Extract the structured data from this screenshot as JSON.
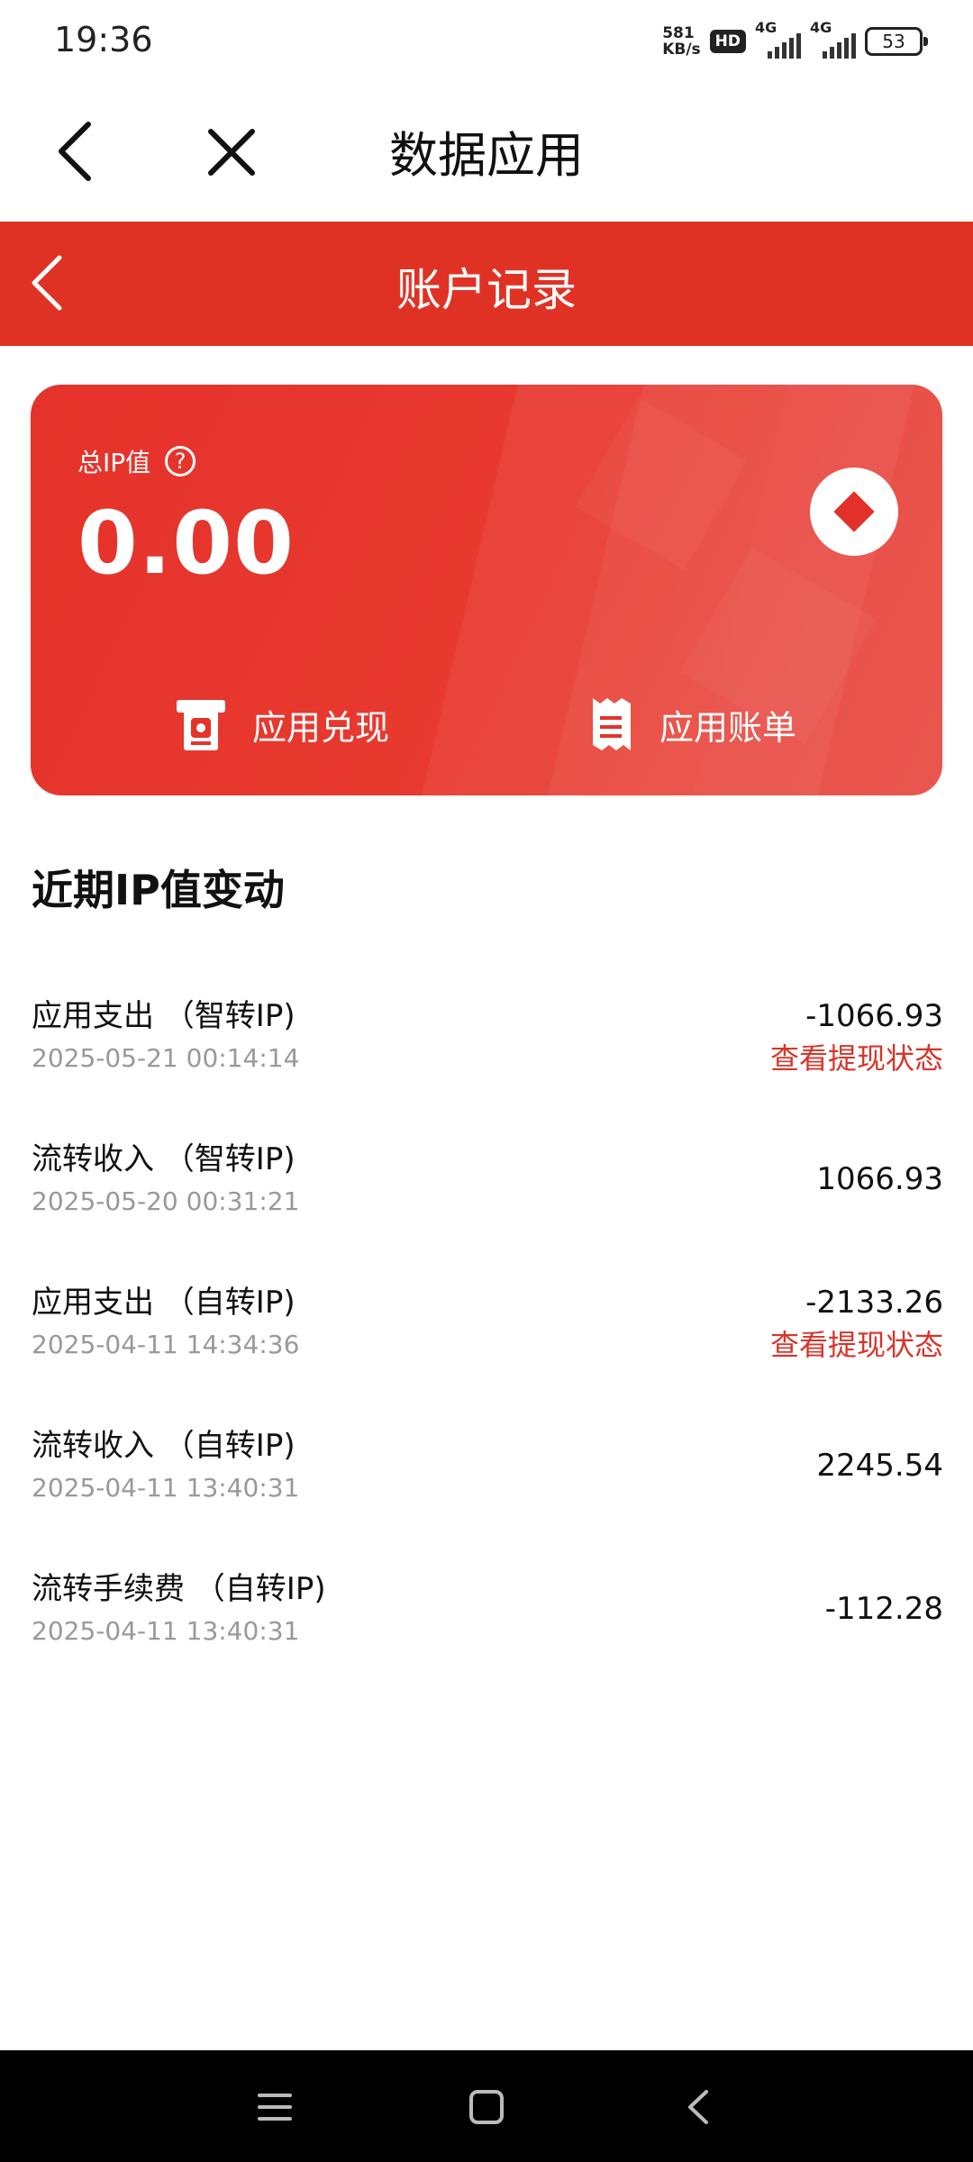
{
  "status_bar": {
    "time": "19:36",
    "net_speed_value": "581",
    "net_speed_unit": "KB/s",
    "hd_label": "HD",
    "network1": "4G",
    "network2": "4G",
    "battery": "53"
  },
  "nav": {
    "title": "数据应用",
    "back_icon": "chevron-left-icon",
    "close_icon": "close-icon"
  },
  "header": {
    "title": "账户记录",
    "back_icon": "chevron-left-icon",
    "color": "#e03224"
  },
  "card": {
    "total_label": "总IP值",
    "help_symbol": "?",
    "total_value": "0.00",
    "actions": [
      {
        "label": "应用兑现",
        "icon": "atm-cash-icon"
      },
      {
        "label": "应用账单",
        "icon": "receipt-icon"
      }
    ]
  },
  "section": {
    "title": "近期IP值变动"
  },
  "records": [
    {
      "title": "应用支出 （智转IP)",
      "time": "2025-05-21 00:14:14",
      "amount": "-1066.93",
      "status": "查看提现状态"
    },
    {
      "title": "流转收入 （智转IP)",
      "time": "2025-05-20 00:31:21",
      "amount": "1066.93",
      "status": ""
    },
    {
      "title": "应用支出 （自转IP)",
      "time": "2025-04-11 14:34:36",
      "amount": "-2133.26",
      "status": "查看提现状态"
    },
    {
      "title": "流转收入 （自转IP)",
      "time": "2025-04-11 13:40:31",
      "amount": "2245.54",
      "status": ""
    },
    {
      "title": "流转手续费 （自转IP)",
      "time": "2025-04-11 13:40:31",
      "amount": "-112.28",
      "status": ""
    }
  ],
  "accent_color": "#d8342a"
}
